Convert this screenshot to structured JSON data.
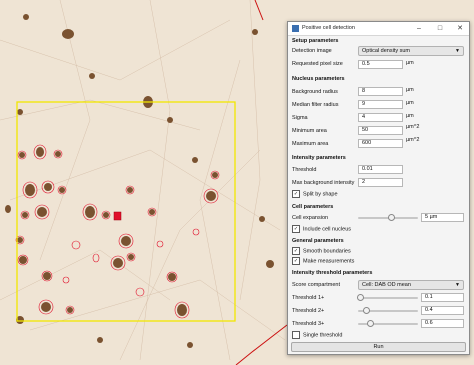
{
  "dialog": {
    "title": "Positive cell detection",
    "window_controls": [
      "minimize-icon",
      "maximize-icon",
      "close-icon"
    ],
    "setup": {
      "header": "Setup parameters",
      "detection_image_label": "Detection image",
      "detection_image_value": "Optical density sum",
      "pixel_size_label": "Requested pixel size",
      "pixel_size_value": "0.5",
      "pixel_size_unit": "µm"
    },
    "nucleus": {
      "header": "Nucleus parameters",
      "background_radius_label": "Background radius",
      "background_radius_value": "8",
      "background_radius_unit": "µm",
      "median_label": "Median filter radius",
      "median_value": "9",
      "median_unit": "µm",
      "sigma_label": "Sigma",
      "sigma_value": "4",
      "sigma_unit": "µm",
      "min_area_label": "Minimum area",
      "min_area_value": "50",
      "min_area_unit": "µm^2",
      "max_area_label": "Maximum area",
      "max_area_value": "600",
      "max_area_unit": "µm^2"
    },
    "intensity": {
      "header": "Intensity parameters",
      "threshold_label": "Threshold",
      "threshold_value": "0.01",
      "max_bg_label": "Max background intensity",
      "max_bg_value": "2",
      "split_label": "Split by shape",
      "split_checked": true
    },
    "cell": {
      "header": "Cell parameters",
      "expansion_label": "Cell expansion",
      "expansion_value": "5 µm",
      "expansion_level": 0.55,
      "include_nucleus_label": "Include cell nucleus",
      "include_nucleus_checked": true
    },
    "general": {
      "header": "General parameters",
      "smooth_label": "Smooth boundaries",
      "smooth_checked": true,
      "measure_label": "Make measurements",
      "measure_checked": true
    },
    "threshold_params": {
      "header": "Intensity threshold parameters",
      "score_label": "Score compartment",
      "score_value": "Cell: DAB OD mean",
      "t1_label": "Threshold 1+",
      "t1_value": "0.1",
      "t1_level": 0.03,
      "t2_label": "Threshold 2+",
      "t2_value": "0.4",
      "t2_level": 0.13,
      "t3_label": "Threshold 3+",
      "t3_value": "0.6",
      "t3_level": 0.2,
      "single_label": "Single threshold",
      "single_checked": false
    },
    "run_label": "Run"
  },
  "viewer": {
    "roi_color": "#f2e600",
    "cell_outline_color": "#e0102a",
    "annotation_line_color": "#cc1010"
  }
}
